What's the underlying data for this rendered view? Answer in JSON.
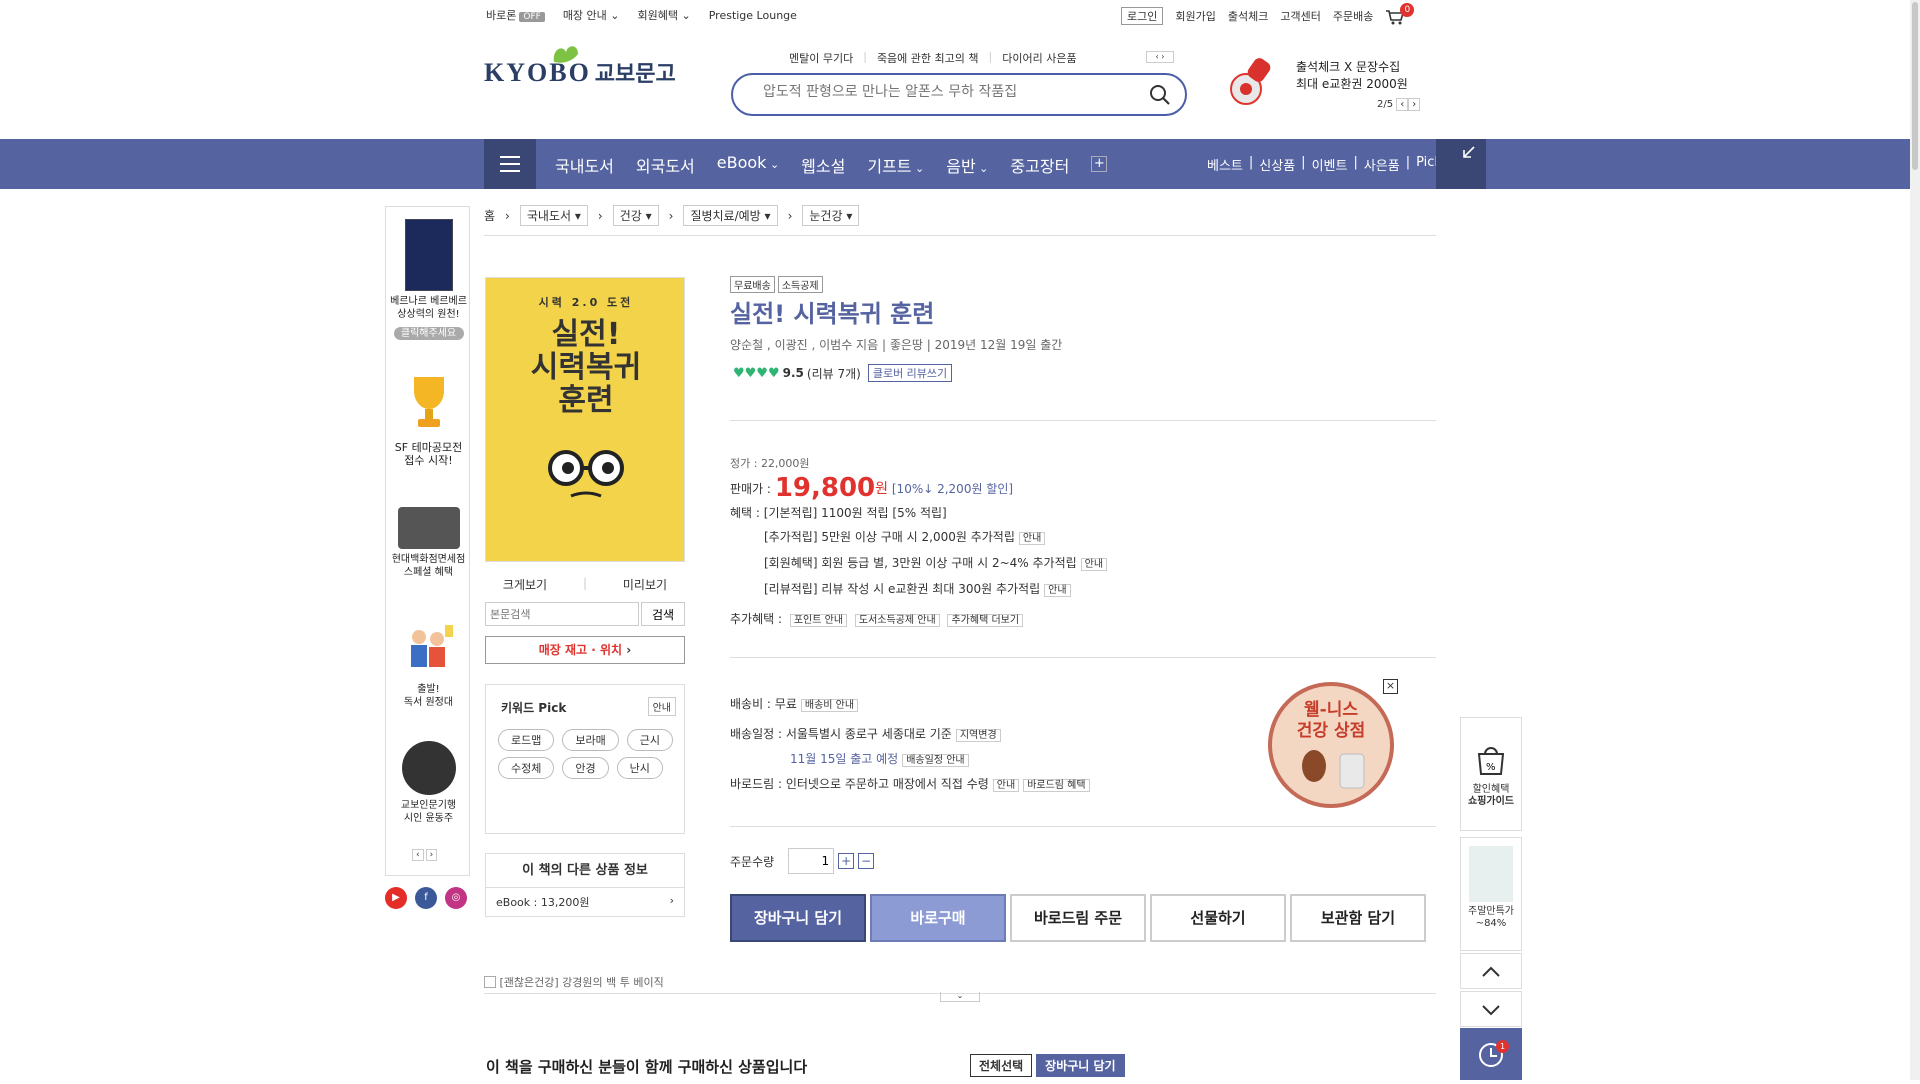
{
  "topbar": {
    "baro": "바로론",
    "baro_state": "OFF",
    "store_info": "매장 안내",
    "member_benefit": "회원혜택",
    "prestige": "Prestige Lounge",
    "login": "로그인",
    "signup": "회원가입",
    "attendance": "출석체크",
    "service": "고객센터",
    "order_delivery": "주문배송",
    "cart_count": "0"
  },
  "header": {
    "logo_en": "KYOBO",
    "logo_ko": "교보문고",
    "hot_words": [
      "멘탈이 무기다",
      "죽음에 관한 최고의 책",
      "다이어리 사은품"
    ],
    "search_placeholder": "압도적 판형으로 만나는 알폰스 무하 작품집",
    "promo_line1": "출석체크 X 문장수집",
    "promo_line2": "최대 e교환권 2000원",
    "promo_page": "2/5"
  },
  "nav": {
    "cats": [
      "국내도서",
      "외국도서",
      "eBook",
      "웹소설",
      "기프트",
      "음반",
      "중고장터"
    ],
    "right": [
      "베스트",
      "신상품",
      "이벤트",
      "사은품",
      "Picks"
    ]
  },
  "breadcrumb": {
    "home": "홈",
    "items": [
      "국내도서",
      "건강",
      "질병치료/예방",
      "눈건강"
    ]
  },
  "left_ads": [
    {
      "text": "베르나르 베르베르\n상상력의 원천!",
      "btn": "클릭해주세요"
    },
    {
      "text": "SF 테마공모전\n접수 시작!"
    },
    {
      "text": "현대백화점면세점\n스페셜 혜택"
    },
    {
      "text": "출발!\n독서 원정대"
    },
    {
      "text": "교보인문기행\n시인 윤동주"
    }
  ],
  "cover": {
    "subtitle": "시력 2.0 도전",
    "title_1": "실전!",
    "title_2": "시력복귀",
    "title_3": "훈련"
  },
  "cover_links": {
    "zoom": "크게보기",
    "preview": "미리보기"
  },
  "body_search": {
    "placeholder": "본문검색",
    "btn": "검색"
  },
  "stock_btn": "매장 재고 · 위치",
  "keywords": {
    "title": "키워드 Pick",
    "info": "안내",
    "tags": [
      "로드맵",
      "보라매",
      "근시",
      "수정체",
      "안경",
      "난시"
    ]
  },
  "other_products": {
    "title": "이 책의 다른 상품 정보",
    "ebook": "eBook : 13,200원"
  },
  "product": {
    "badges": [
      "무료배송",
      "소득공제"
    ],
    "title": "실전! 시력복귀 훈련",
    "meta": "양순철 , 이광진 , 이범수 지음 | 좋은땅 | 2019년 12월 19일 출간",
    "rating": "9.5",
    "reviews": "(리뷰 7개)",
    "review_btn": "클로버 리뷰쓰기",
    "list_price": "정가 : 22,000원",
    "sale_label": "판매가 :",
    "sale_price": "19,800",
    "won": "원",
    "discount": "[10%↓ 2,200원 할인]",
    "benefit_label": "혜택 :",
    "benefit_basic": "[기본적립] 1100원 적립 [5% 적립]",
    "benefit_extra": "[추가적립] 5만원 이상 구매 시 2,000원 추가적립",
    "benefit_member": "[회원혜택] 회원 등급 별, 3만원 이상 구매 시 2~4% 추가적립",
    "benefit_review": "[리뷰적립] 리뷰 작성 시 e교환권 최대 300원 추가적립",
    "guide": "안내",
    "extra_label": "추가혜택 :",
    "extra_btns": [
      "포인트 안내",
      "도서소득공제 안내",
      "추가혜택 더보기"
    ],
    "ship_cost": "배송비 : 무료",
    "ship_cost_btn": "배송비 안내",
    "ship_sched": "배송일정 : 서울특별시 종로구 세종대로 기준",
    "ship_change": "지역변경",
    "ship_date": "11월 15일 출고 예정",
    "ship_sched_btn": "배송일정 안내",
    "barodrim": "바로드림 : 인터넷으로 주문하고 매장에서 직접 수령",
    "barodrim_guide": "안내",
    "barodrim_benefit": "바로드림 혜택",
    "qty_label": "주문수량",
    "qty_value": "1",
    "actions": [
      "장바구니 담기",
      "바로구매",
      "바로드림 주문",
      "선물하기",
      "보관함 담기"
    ]
  },
  "well_banner": {
    "line1": "웰-니스",
    "line2": "건강 상점"
  },
  "banner_text": "[괜찮은건강] 강경원의 백 투 베이직",
  "together": {
    "title": "이 책을 구매하신 분들이 함께 구매하신 상품입니다",
    "select_all": "전체선택",
    "add_cart": "장바구니 담기"
  },
  "right_side": {
    "guide_1": "할인혜택",
    "guide_2": "쇼핑가이드",
    "weekly_1": "주말만특가",
    "weekly_2": "~84%",
    "recent_count": "1"
  },
  "colors": {
    "accent": "#5563a0",
    "price_red": "#e0322e",
    "heart_green": "#2fb573"
  }
}
